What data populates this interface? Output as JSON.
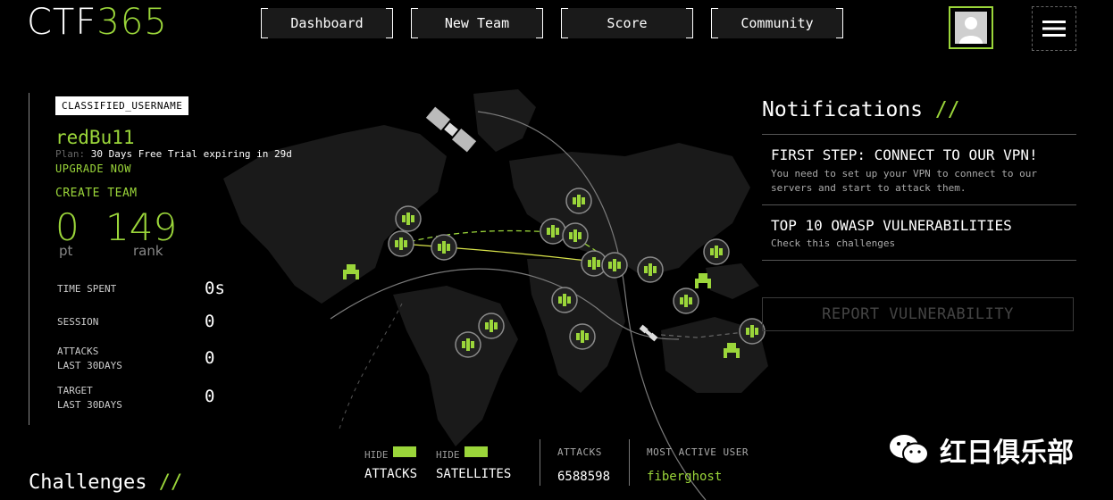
{
  "header": {
    "logo_a": "CTF",
    "logo_b": "365",
    "nav": [
      "Dashboard",
      "New Team",
      "Score",
      "Community"
    ]
  },
  "profile": {
    "username_tag": "CLASSIFIED_USERNAME",
    "username": "redBu11",
    "plan_key": "Plan:",
    "plan_value": "30 Days Free Trial expiring in 29d",
    "upgrade": "UPGRADE NOW",
    "create_team": "CREATE TEAM",
    "points": "0",
    "points_label": "pt",
    "rank": "149",
    "rank_label": "rank",
    "stats": [
      {
        "label1": "TIME SPENT",
        "label2": "",
        "value": "0s"
      },
      {
        "label1": "SESSION",
        "label2": "",
        "value": "0"
      },
      {
        "label1": "ATTACKS",
        "label2": "LAST 30DAYS",
        "value": "0"
      },
      {
        "label1": "TARGET",
        "label2": "LAST 30DAYS",
        "value": "0"
      }
    ]
  },
  "challenges": {
    "title": "Challenges",
    "slashes": "//"
  },
  "notifications": {
    "title": "Notifications",
    "slashes": "//",
    "items": [
      {
        "title": "FIRST STEP: CONNECT TO OUR VPN!",
        "desc": "You need to set up your VPN to connect to our servers and start to attack them."
      },
      {
        "title": "TOP 10 OWASP VULNERABILITIES",
        "desc": "Check this challenges"
      }
    ],
    "report": "REPORT VULNERABILITY"
  },
  "bottom": {
    "hide1": "HIDE",
    "attacks_btn": "ATTACKS",
    "hide2": "HIDE",
    "satellites_btn": "SATELLITES",
    "attacks_label": "ATTACKS",
    "attacks_value": "6588598",
    "active_label": "MOST ACTIVE USER",
    "active_value": "fiberghost"
  },
  "watermark": "红日俱乐部",
  "colors": {
    "accent": "#9bd63a",
    "background": "#000000"
  }
}
